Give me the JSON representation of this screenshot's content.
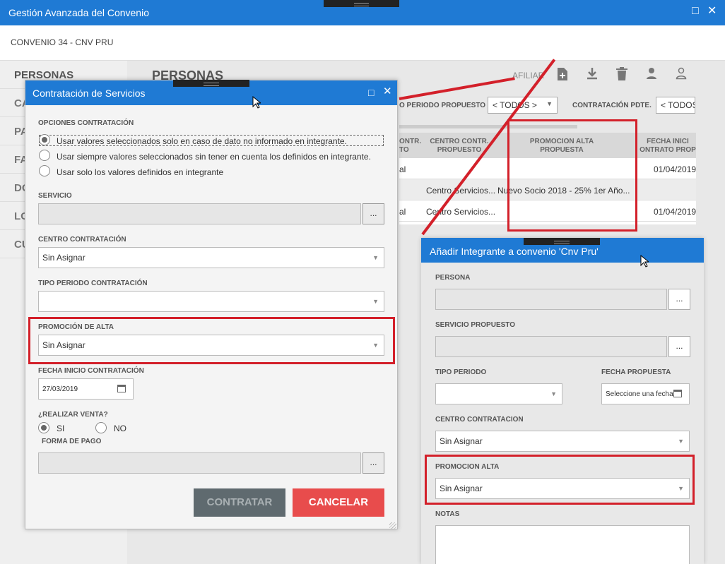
{
  "main_window": {
    "title": "Gestión Avanzada del Convenio",
    "subtitle": "CONVENIO 34 - CNV PRU",
    "maximize_icon": "□",
    "close_icon": "✕"
  },
  "sidebar": {
    "items": [
      "PERSONAS",
      "CA",
      "PA",
      "FA",
      "DO",
      "LO",
      "CU"
    ]
  },
  "content": {
    "title": "PERSONAS",
    "afiliar_label": "AFILIAR",
    "toolbar_icons": [
      "add-document-icon",
      "download-icon",
      "trash-icon",
      "person-icon",
      "person-outline-icon"
    ],
    "filters": [
      {
        "label": "O PERIODO PROPUESTO",
        "value": "< TODOS >"
      },
      {
        "label": "CONTRATACIÓN PDTE.",
        "value": "< TODOS"
      }
    ],
    "grid": {
      "headers": [
        "ONTR.\nTO",
        "CENTRO CONTR.\nPROPUESTO",
        "PROMOCION ALTA\nPROPUESTA",
        "FECHA INICI\nONTRATO PROP"
      ],
      "rows": [
        [
          "al",
          "",
          "",
          "01/04/2019"
        ],
        [
          "",
          "Centro Servicios...",
          "Nuevo Socio 2018  - 25% 1er Año...",
          ""
        ],
        [
          "al",
          "Centro Servicios...",
          "",
          "01/04/2019"
        ]
      ]
    }
  },
  "dialog_contratacion": {
    "title": "Contratación de Servicios",
    "opciones_label": "OPCIONES CONTRATACIÓN",
    "opciones": [
      "Usar valores seleccionados solo en caso de dato no informado en integrante.",
      "Usar siempre valores seleccionados sin tener en cuenta los definidos en integrante.",
      "Usar solo los valores definidos en integrante"
    ],
    "servicio_label": "SERVICIO",
    "servicio_value": "",
    "dots": "...",
    "centro_label": "CENTRO CONTRATACIÓN",
    "centro_value": "Sin Asignar",
    "tipo_periodo_label": "TIPO PERIODO CONTRATACIÓN",
    "tipo_periodo_value": "",
    "promocion_label": "PROMOCIÓN DE ALTA",
    "promocion_value": "Sin Asignar",
    "fecha_label": "FECHA INICIO CONTRATACIÓN",
    "fecha_value": "27/03/2019",
    "venta_label": "¿REALIZAR VENTA?",
    "venta_si": "SI",
    "venta_no": "NO",
    "forma_pago_label": "FORMA DE PAGO",
    "contratar_label": "CONTRATAR",
    "cancelar_label": "CANCELAR"
  },
  "dialog_integrante": {
    "title": "Añadir Integrante a convenio 'Cnv Pru'",
    "persona_label": "PERSONA",
    "servicio_label": "SERVICIO PROPUESTO",
    "dots": "...",
    "tipo_periodo_label": "TIPO PERIODO",
    "fecha_label": "FECHA PROPUESTA",
    "fecha_placeholder": "Seleccione una fecha",
    "centro_label": "CENTRO CONTRATACION",
    "centro_value": "Sin Asignar",
    "promocion_label": "PROMOCION ALTA",
    "promocion_value": "Sin Asignar",
    "notas_label": "NOTAS"
  },
  "colors": {
    "title_blue": "#1f7ad4",
    "highlight_red": "#d3202a",
    "cancel_red": "#e84c4c",
    "contratar_gray": "#5f6a6f"
  }
}
